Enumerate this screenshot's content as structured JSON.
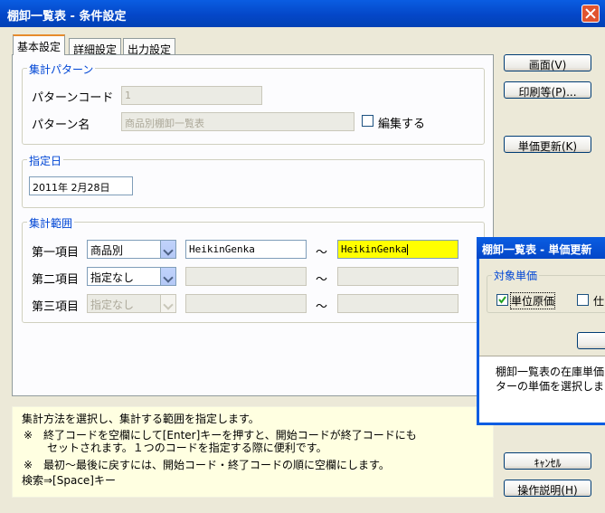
{
  "window": {
    "title": "棚卸一覧表 - 条件設定"
  },
  "tabs": [
    {
      "label": "基本設定"
    },
    {
      "label": "詳細設定"
    },
    {
      "label": "出力設定"
    }
  ],
  "pattern": {
    "group_label": "集計パターン",
    "code_label": "パターンコード",
    "code_value": "1",
    "name_label": "パターン名",
    "name_value": "商品別棚卸一覧表",
    "edit_label": "編集する"
  },
  "date": {
    "group_label": "指定日",
    "value": "2011年 2月28日"
  },
  "range": {
    "group_label": "集計範囲",
    "tilde": "～",
    "rows": [
      {
        "label": "第一項目",
        "select": "商品別",
        "from": "HeikinGenka",
        "to": "HeikinGenka"
      },
      {
        "label": "第二項目",
        "select": "指定なし",
        "from": "",
        "to": ""
      },
      {
        "label": "第三項目",
        "select": "指定なし",
        "from": "",
        "to": ""
      }
    ]
  },
  "buttons": {
    "screen": "画面(V)",
    "print": "印刷等(P)...",
    "unit_update": "単価更新(K)",
    "cancel": "ｷｬﾝｾﾙ",
    "help": "操作説明(H)"
  },
  "help": {
    "line1": "集計方法を選択し、集計する範囲を指定します。",
    "line2": "※　終了コードを空欄にして[Enter]キーを押すと、開始コードが終了コードにも",
    "line3": "セットされます。１つのコードを指定する際に便利です。",
    "line4": "※　最初～最後に戻すには、開始コード・終了コードの順に空欄にします。",
    "line5": "検索⇒[Space]キー"
  },
  "popup": {
    "title": "棚卸一覧表 - 単価更新",
    "group_label": "対象単価",
    "check1": "単位原価",
    "check2": "仕",
    "text1": "棚卸一覧表の在庫単価",
    "text2": "ターの単価を選択しま"
  }
}
